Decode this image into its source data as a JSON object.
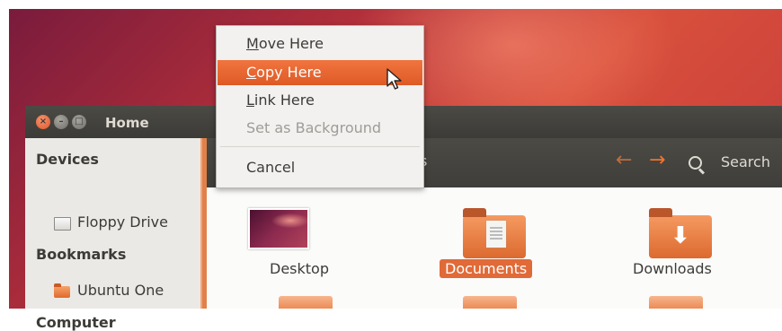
{
  "window": {
    "title": "Home"
  },
  "titlebar": {
    "close": "×",
    "min": "–",
    "max": "□"
  },
  "toolbar": {
    "location_fragment": "s",
    "back_icon": "←",
    "forward_icon": "→",
    "search_label": "Search"
  },
  "sidebar": {
    "sections": [
      {
        "header": "Devices",
        "items": [
          "Floppy Drive"
        ]
      },
      {
        "header": "Bookmarks",
        "items": [
          "Ubuntu One"
        ]
      },
      {
        "header": "Computer",
        "items": []
      }
    ]
  },
  "files": [
    {
      "label": "Desktop",
      "selected": false
    },
    {
      "label": "Documents",
      "selected": true
    },
    {
      "label": "Downloads",
      "selected": false
    }
  ],
  "context_menu": {
    "items": [
      {
        "mnemonic": "M",
        "rest": "ove Here",
        "state": "normal"
      },
      {
        "mnemonic": "C",
        "rest": "opy Here",
        "state": "highlighted"
      },
      {
        "mnemonic": "L",
        "rest": "ink Here",
        "state": "normal"
      },
      {
        "label": "Set as Background",
        "state": "disabled"
      },
      {
        "label": "Cancel",
        "state": "normal"
      }
    ]
  },
  "colors": {
    "accent": "#e06a38",
    "highlight": "#f1743f",
    "titlebar": "#3c3b37"
  }
}
